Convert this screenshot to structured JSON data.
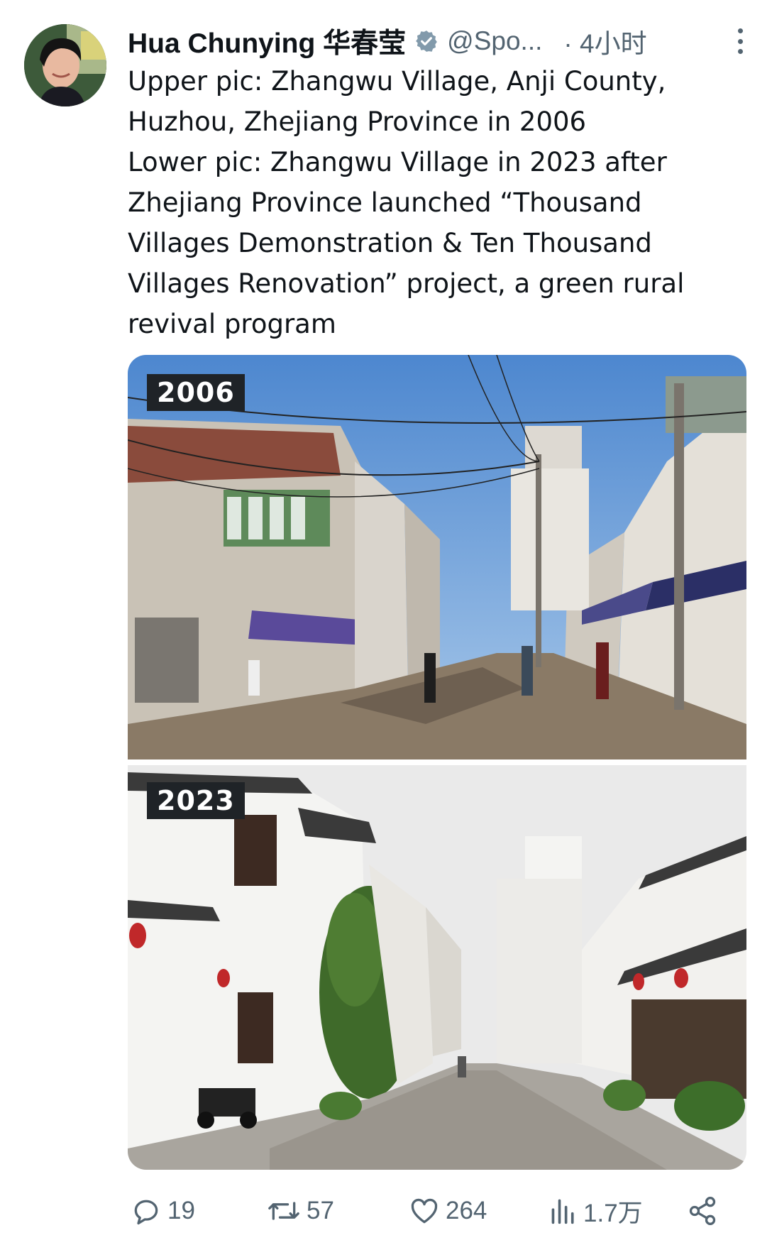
{
  "author": {
    "display_name": "Hua Chunying 华春莹",
    "handle": "@Spo...",
    "time": "· 4小时",
    "verified_icon": "verified-badge-icon",
    "avatar_icon": "profile-avatar"
  },
  "tweet": {
    "lines": [
      "Upper pic: Zhangwu Village, Anji County,",
      "Huzhou, Zhejiang Province in 2006",
      "Lower pic: Zhangwu Village in 2023 after",
      "Zhejiang Province launched “Thousand",
      "Villages Demonstration & Ten Thousand",
      "Villages Renovation” project, a green rural",
      "revival program"
    ]
  },
  "media": {
    "top_year": "2006",
    "bottom_year": "2023"
  },
  "actions": {
    "replies": "19",
    "reposts": "57",
    "likes": "264",
    "views": "1.7万"
  },
  "colors": {
    "text": "#0f1419",
    "secondary": "#536471",
    "verified": "#829aab",
    "badge_bg": "#1f2327"
  }
}
